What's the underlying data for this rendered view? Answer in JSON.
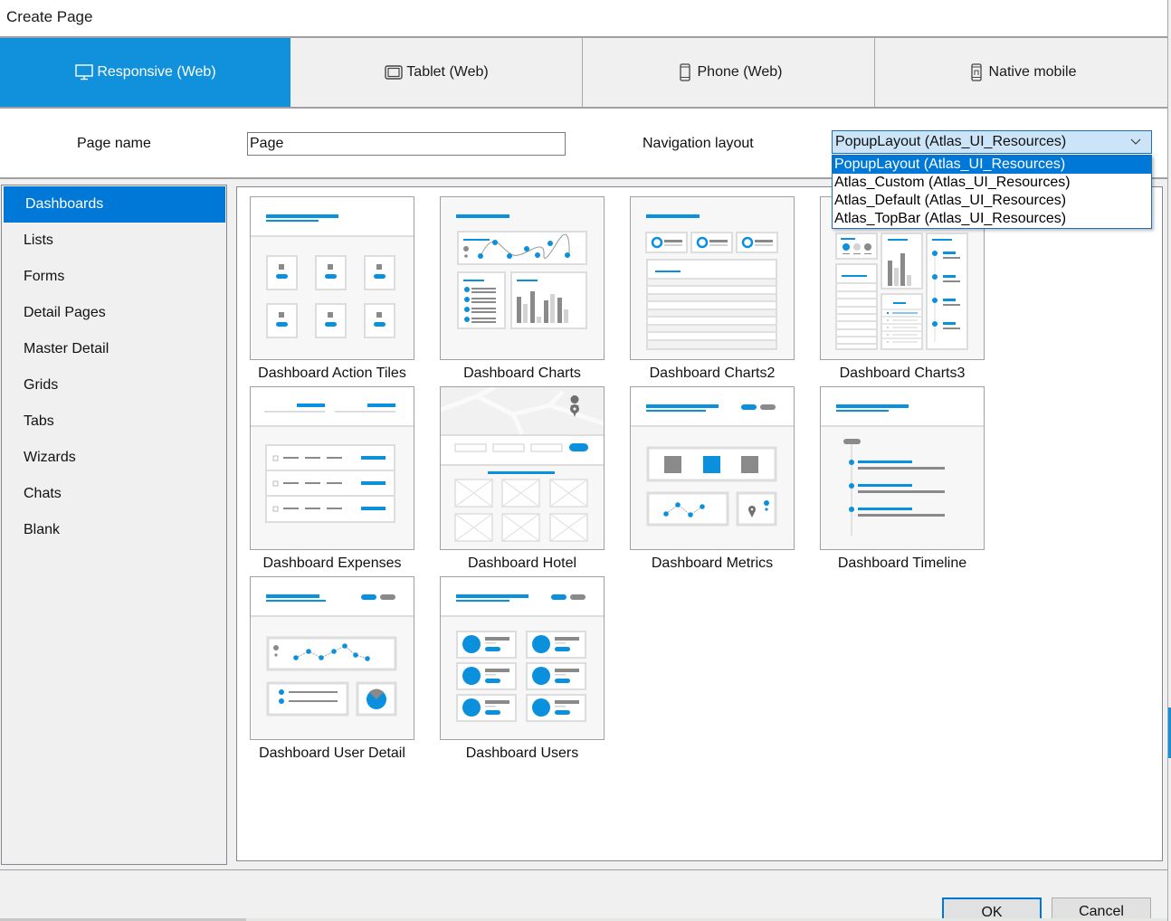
{
  "window": {
    "title": "Create Page"
  },
  "device_tabs": [
    {
      "label": "Responsive (Web)",
      "icon": "monitor-icon",
      "active": true
    },
    {
      "label": "Tablet (Web)",
      "icon": "tablet-icon",
      "active": false
    },
    {
      "label": "Phone (Web)",
      "icon": "phone-icon",
      "active": false
    },
    {
      "label": "Native mobile",
      "icon": "native-mobile-icon",
      "active": false
    }
  ],
  "form": {
    "page_name_label": "Page name",
    "page_name_value": "Page",
    "nav_layout_label": "Navigation layout",
    "nav_layout_selected": "PopupLayout (Atlas_UI_Resources)",
    "nav_layout_options": [
      "PopupLayout (Atlas_UI_Resources)",
      "Atlas_Custom (Atlas_UI_Resources)",
      "Atlas_Default (Atlas_UI_Resources)",
      "Atlas_TopBar (Atlas_UI_Resources)"
    ]
  },
  "categories": [
    {
      "label": "Dashboards",
      "active": true
    },
    {
      "label": "Lists"
    },
    {
      "label": "Forms"
    },
    {
      "label": "Detail Pages"
    },
    {
      "label": "Master Detail"
    },
    {
      "label": "Grids"
    },
    {
      "label": "Tabs"
    },
    {
      "label": "Wizards"
    },
    {
      "label": "Chats"
    },
    {
      "label": "Blank"
    }
  ],
  "templates": [
    {
      "name": "Dashboard Action Tiles",
      "kind": "action-tiles"
    },
    {
      "name": "Dashboard Charts",
      "kind": "charts"
    },
    {
      "name": "Dashboard Charts2",
      "kind": "charts2"
    },
    {
      "name": "Dashboard Charts3",
      "kind": "charts3"
    },
    {
      "name": "Dashboard Expenses",
      "kind": "expenses"
    },
    {
      "name": "Dashboard Hotel",
      "kind": "hotel"
    },
    {
      "name": "Dashboard Metrics",
      "kind": "metrics"
    },
    {
      "name": "Dashboard Timeline",
      "kind": "timeline"
    },
    {
      "name": "Dashboard User Detail",
      "kind": "user-detail"
    },
    {
      "name": "Dashboard Users",
      "kind": "users"
    }
  ],
  "buttons": {
    "ok": "OK",
    "cancel": "Cancel"
  },
  "colors": {
    "accent": "#1191dc",
    "selection": "#0078d7",
    "thumb_blue": "#0a90dc",
    "thumb_gray": "#8a8a8a"
  }
}
